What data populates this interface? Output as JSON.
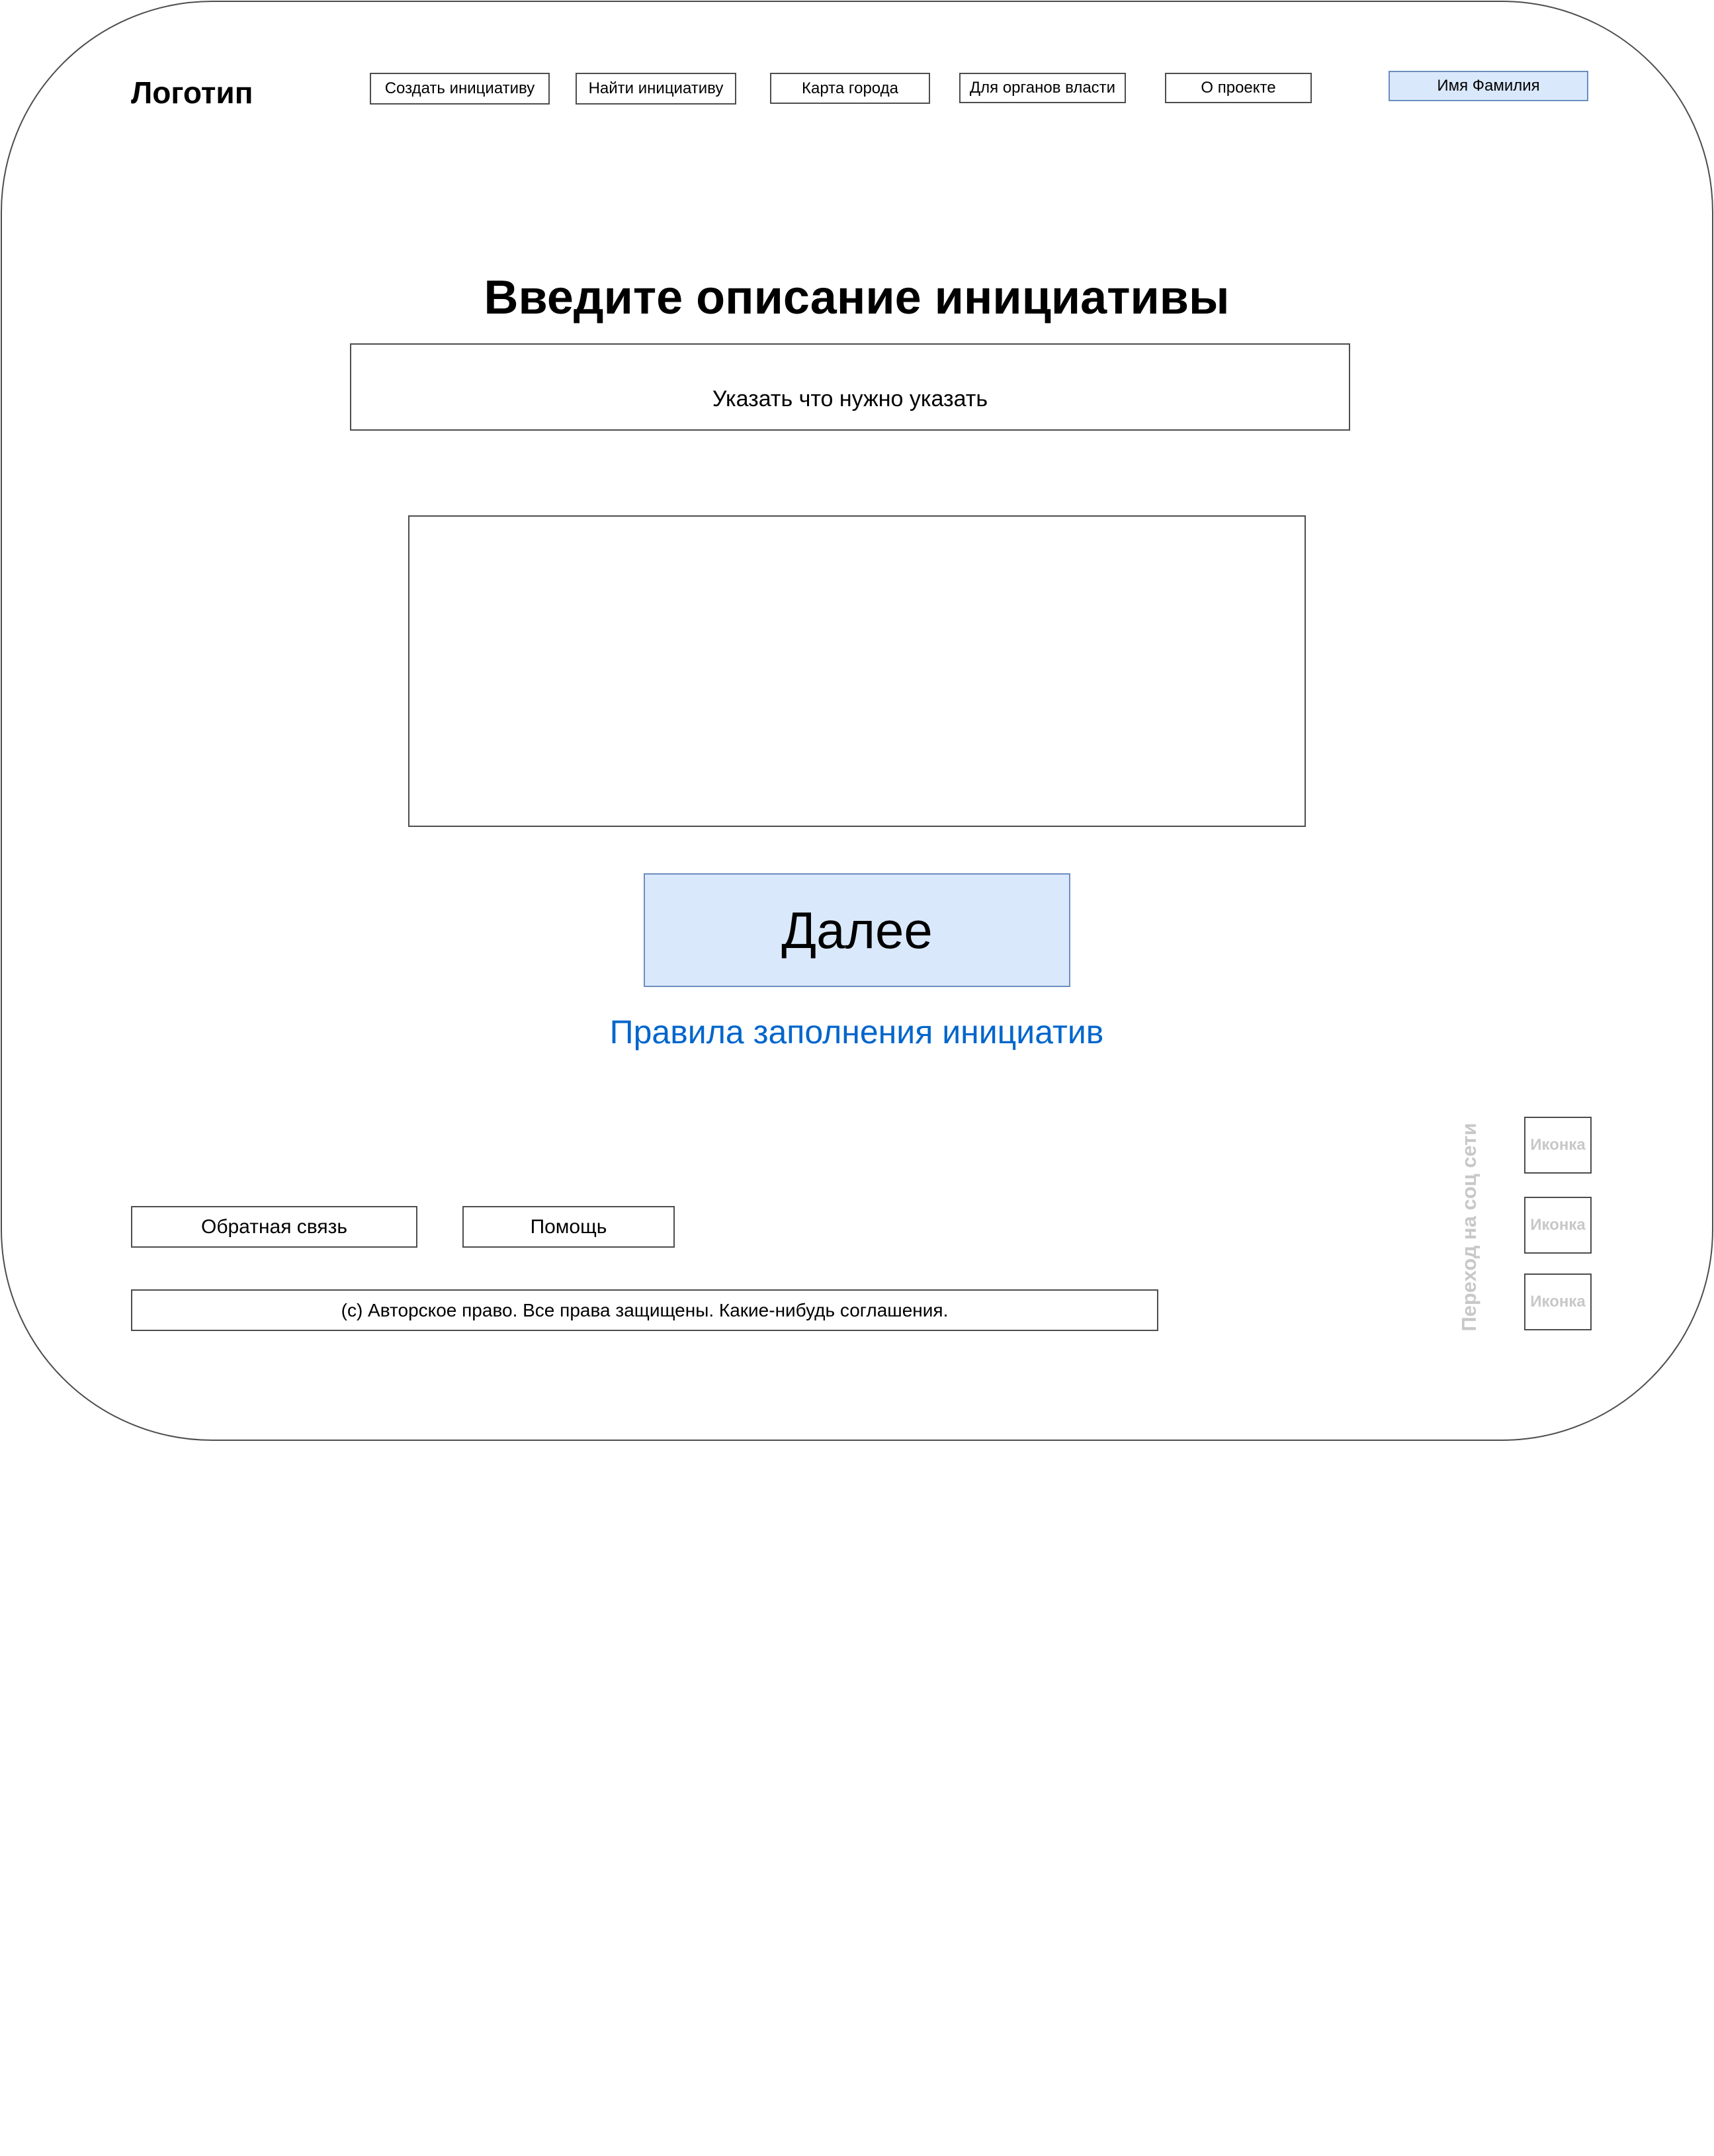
{
  "header": {
    "logo": "Логотип",
    "nav": {
      "create": "Создать инициативу",
      "find": "Найти инициативу",
      "map": "Карта города",
      "authorities": "Для органов власти",
      "about": "О проекте"
    },
    "user_name": "Имя Фамилия"
  },
  "main": {
    "heading": "Введите описание инициативы",
    "title_field_text": "Указать что нужно указать",
    "description_value": "",
    "next_button": "Далее",
    "rules_link": "Правила заполнения инициатив"
  },
  "footer": {
    "feedback": "Обратная связь",
    "help": "Помощь",
    "copyright": "(c) Авторское право. Все права защищены. Какие-нибудь соглашения.",
    "social_label": "Переход на соц сети",
    "social_icons": [
      "Иконка",
      "Иконка",
      "Иконка"
    ]
  },
  "colors": {
    "accent_fill": "#dae8fc",
    "accent_border": "#6c8ebf",
    "link": "#0066cc",
    "muted": "#c8c8c8",
    "border": "#4d4d4d"
  }
}
